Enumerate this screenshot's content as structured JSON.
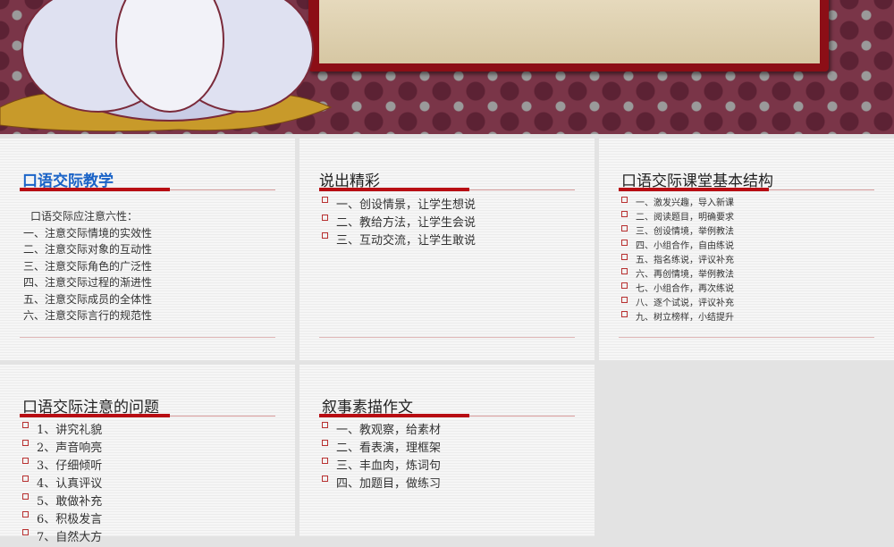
{
  "cards": [
    {
      "title": "口语交际教学",
      "items": [
        "口语交际应注意六性：",
        "一、注意交际情境的实效性",
        "二、注意交际对象的互动性",
        "三、注意交际角色的广泛性",
        "四、注意交际过程的渐进性",
        "五、注意交际成员的全体性",
        "六、注意交际言行的规范性"
      ]
    },
    {
      "title": "说出精彩",
      "items": [
        "一、创设情景，让学生想说",
        "二、教给方法，让学生会说",
        "三、互动交流，让学生敢说"
      ]
    },
    {
      "title": "口语交际课堂基本结构",
      "items": [
        "一、激发兴趣，导入新课",
        "二、阅读题目，明确要求",
        "三、创设情境，举例教法",
        "四、小组合作，自由练说",
        "五、指名练说，评议补充",
        "六、再创情境，举例教法",
        "七、小组合作，再次练说",
        "八、逐个试说，评议补充",
        "九、树立榜样，小结提升"
      ]
    },
    {
      "title": "口语交际注意的问题",
      "items": [
        "1、讲究礼貌",
        "2、声音响亮",
        "3、仔细倾听",
        "4、认真评议",
        "5、敢做补充",
        "6、积极发言",
        "7、自然大方"
      ]
    },
    {
      "title": "叙事素描作文",
      "items": [
        "一、教观察，给素材",
        "二、看表演，理框架",
        "三、丰血肉，炼词句",
        "四、加题目，做练习"
      ]
    }
  ]
}
